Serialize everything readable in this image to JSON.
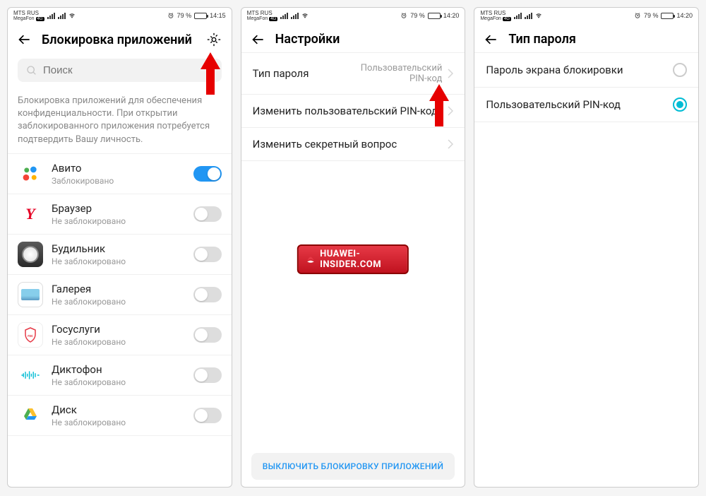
{
  "status": {
    "carrier": "MTS RUS",
    "subcarrier": "MegaFon",
    "battery_percent": "79 %",
    "time1": "14:15",
    "time2": "14:20",
    "time3": "14:20"
  },
  "screen1": {
    "title": "Блокировка приложений",
    "search_placeholder": "Поиск",
    "description": "Блокировка приложений для обеспечения конфиденциальности. При открытии заблокированного приложения потребуется подтвердить Вашу личность.",
    "apps": [
      {
        "name": "Авито",
        "status": "Заблокировано",
        "locked": true
      },
      {
        "name": "Браузер",
        "status": "Не заблокировано",
        "locked": false
      },
      {
        "name": "Будильник",
        "status": "Не заблокировано",
        "locked": false
      },
      {
        "name": "Галерея",
        "status": "Не заблокировано",
        "locked": false
      },
      {
        "name": "Госуслуги",
        "status": "Не заблокировано",
        "locked": false
      },
      {
        "name": "Диктофон",
        "status": "Не заблокировано",
        "locked": false
      },
      {
        "name": "Диск",
        "status": "Не заблокировано",
        "locked": false
      }
    ]
  },
  "screen2": {
    "title": "Настройки",
    "rows": [
      {
        "label": "Тип пароля",
        "value": "Пользовательский PIN-код"
      },
      {
        "label": "Изменить пользовательский PIN-код",
        "value": ""
      },
      {
        "label": "Изменить секретный вопрос",
        "value": ""
      }
    ],
    "bottom_button": "ВЫКЛЮЧИТЬ БЛОКИРОВКУ ПРИЛОЖЕНИЙ",
    "watermark": "HUAWEI-INSIDER.COM"
  },
  "screen3": {
    "title": "Тип пароля",
    "options": [
      {
        "label": "Пароль экрана блокировки",
        "checked": false
      },
      {
        "label": "Пользовательский PIN-код",
        "checked": true
      }
    ]
  }
}
